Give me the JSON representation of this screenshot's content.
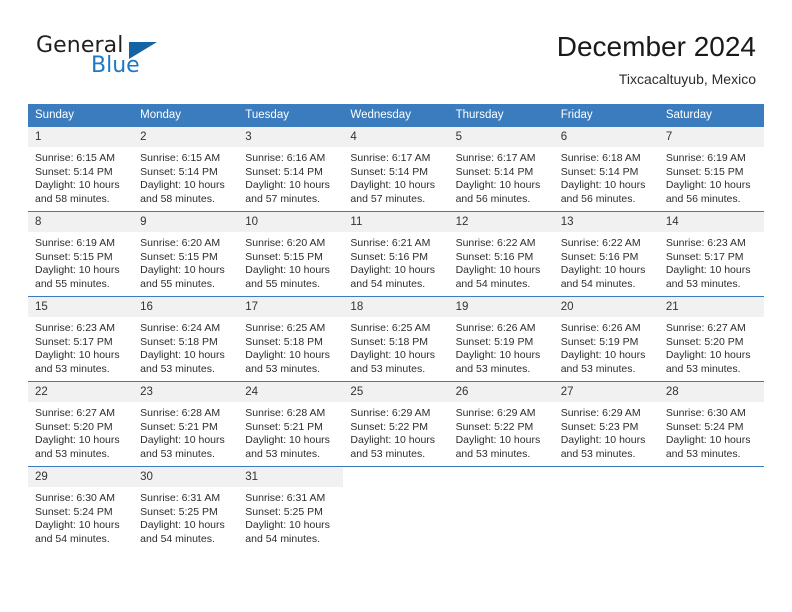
{
  "brand": {
    "name_part1": "General",
    "name_part2": "Blue",
    "triangle_color": "#1464a5",
    "blue_color": "#1e78c8"
  },
  "header": {
    "title": "December 2024",
    "subtitle": "Tixcacaltuyub, Mexico"
  },
  "theme": {
    "header_row_bg": "#3a7cbe",
    "daynum_bg": "#f1f1f1",
    "grid_line": "#3a7cbe",
    "text": "#2d2d2d"
  },
  "weekday_headers": [
    "Sunday",
    "Monday",
    "Tuesday",
    "Wednesday",
    "Thursday",
    "Friday",
    "Saturday"
  ],
  "weeks": [
    [
      {
        "day": "1",
        "sunrise": "Sunrise: 6:15 AM",
        "sunset": "Sunset: 5:14 PM",
        "daylight1": "Daylight: 10 hours",
        "daylight2": "and 58 minutes."
      },
      {
        "day": "2",
        "sunrise": "Sunrise: 6:15 AM",
        "sunset": "Sunset: 5:14 PM",
        "daylight1": "Daylight: 10 hours",
        "daylight2": "and 58 minutes."
      },
      {
        "day": "3",
        "sunrise": "Sunrise: 6:16 AM",
        "sunset": "Sunset: 5:14 PM",
        "daylight1": "Daylight: 10 hours",
        "daylight2": "and 57 minutes."
      },
      {
        "day": "4",
        "sunrise": "Sunrise: 6:17 AM",
        "sunset": "Sunset: 5:14 PM",
        "daylight1": "Daylight: 10 hours",
        "daylight2": "and 57 minutes."
      },
      {
        "day": "5",
        "sunrise": "Sunrise: 6:17 AM",
        "sunset": "Sunset: 5:14 PM",
        "daylight1": "Daylight: 10 hours",
        "daylight2": "and 56 minutes."
      },
      {
        "day": "6",
        "sunrise": "Sunrise: 6:18 AM",
        "sunset": "Sunset: 5:14 PM",
        "daylight1": "Daylight: 10 hours",
        "daylight2": "and 56 minutes."
      },
      {
        "day": "7",
        "sunrise": "Sunrise: 6:19 AM",
        "sunset": "Sunset: 5:15 PM",
        "daylight1": "Daylight: 10 hours",
        "daylight2": "and 56 minutes."
      }
    ],
    [
      {
        "day": "8",
        "sunrise": "Sunrise: 6:19 AM",
        "sunset": "Sunset: 5:15 PM",
        "daylight1": "Daylight: 10 hours",
        "daylight2": "and 55 minutes."
      },
      {
        "day": "9",
        "sunrise": "Sunrise: 6:20 AM",
        "sunset": "Sunset: 5:15 PM",
        "daylight1": "Daylight: 10 hours",
        "daylight2": "and 55 minutes."
      },
      {
        "day": "10",
        "sunrise": "Sunrise: 6:20 AM",
        "sunset": "Sunset: 5:15 PM",
        "daylight1": "Daylight: 10 hours",
        "daylight2": "and 55 minutes."
      },
      {
        "day": "11",
        "sunrise": "Sunrise: 6:21 AM",
        "sunset": "Sunset: 5:16 PM",
        "daylight1": "Daylight: 10 hours",
        "daylight2": "and 54 minutes."
      },
      {
        "day": "12",
        "sunrise": "Sunrise: 6:22 AM",
        "sunset": "Sunset: 5:16 PM",
        "daylight1": "Daylight: 10 hours",
        "daylight2": "and 54 minutes."
      },
      {
        "day": "13",
        "sunrise": "Sunrise: 6:22 AM",
        "sunset": "Sunset: 5:16 PM",
        "daylight1": "Daylight: 10 hours",
        "daylight2": "and 54 minutes."
      },
      {
        "day": "14",
        "sunrise": "Sunrise: 6:23 AM",
        "sunset": "Sunset: 5:17 PM",
        "daylight1": "Daylight: 10 hours",
        "daylight2": "and 53 minutes."
      }
    ],
    [
      {
        "day": "15",
        "sunrise": "Sunrise: 6:23 AM",
        "sunset": "Sunset: 5:17 PM",
        "daylight1": "Daylight: 10 hours",
        "daylight2": "and 53 minutes."
      },
      {
        "day": "16",
        "sunrise": "Sunrise: 6:24 AM",
        "sunset": "Sunset: 5:18 PM",
        "daylight1": "Daylight: 10 hours",
        "daylight2": "and 53 minutes."
      },
      {
        "day": "17",
        "sunrise": "Sunrise: 6:25 AM",
        "sunset": "Sunset: 5:18 PM",
        "daylight1": "Daylight: 10 hours",
        "daylight2": "and 53 minutes."
      },
      {
        "day": "18",
        "sunrise": "Sunrise: 6:25 AM",
        "sunset": "Sunset: 5:18 PM",
        "daylight1": "Daylight: 10 hours",
        "daylight2": "and 53 minutes."
      },
      {
        "day": "19",
        "sunrise": "Sunrise: 6:26 AM",
        "sunset": "Sunset: 5:19 PM",
        "daylight1": "Daylight: 10 hours",
        "daylight2": "and 53 minutes."
      },
      {
        "day": "20",
        "sunrise": "Sunrise: 6:26 AM",
        "sunset": "Sunset: 5:19 PM",
        "daylight1": "Daylight: 10 hours",
        "daylight2": "and 53 minutes."
      },
      {
        "day": "21",
        "sunrise": "Sunrise: 6:27 AM",
        "sunset": "Sunset: 5:20 PM",
        "daylight1": "Daylight: 10 hours",
        "daylight2": "and 53 minutes."
      }
    ],
    [
      {
        "day": "22",
        "sunrise": "Sunrise: 6:27 AM",
        "sunset": "Sunset: 5:20 PM",
        "daylight1": "Daylight: 10 hours",
        "daylight2": "and 53 minutes."
      },
      {
        "day": "23",
        "sunrise": "Sunrise: 6:28 AM",
        "sunset": "Sunset: 5:21 PM",
        "daylight1": "Daylight: 10 hours",
        "daylight2": "and 53 minutes."
      },
      {
        "day": "24",
        "sunrise": "Sunrise: 6:28 AM",
        "sunset": "Sunset: 5:21 PM",
        "daylight1": "Daylight: 10 hours",
        "daylight2": "and 53 minutes."
      },
      {
        "day": "25",
        "sunrise": "Sunrise: 6:29 AM",
        "sunset": "Sunset: 5:22 PM",
        "daylight1": "Daylight: 10 hours",
        "daylight2": "and 53 minutes."
      },
      {
        "day": "26",
        "sunrise": "Sunrise: 6:29 AM",
        "sunset": "Sunset: 5:22 PM",
        "daylight1": "Daylight: 10 hours",
        "daylight2": "and 53 minutes."
      },
      {
        "day": "27",
        "sunrise": "Sunrise: 6:29 AM",
        "sunset": "Sunset: 5:23 PM",
        "daylight1": "Daylight: 10 hours",
        "daylight2": "and 53 minutes."
      },
      {
        "day": "28",
        "sunrise": "Sunrise: 6:30 AM",
        "sunset": "Sunset: 5:24 PM",
        "daylight1": "Daylight: 10 hours",
        "daylight2": "and 53 minutes."
      }
    ],
    [
      {
        "day": "29",
        "sunrise": "Sunrise: 6:30 AM",
        "sunset": "Sunset: 5:24 PM",
        "daylight1": "Daylight: 10 hours",
        "daylight2": "and 54 minutes."
      },
      {
        "day": "30",
        "sunrise": "Sunrise: 6:31 AM",
        "sunset": "Sunset: 5:25 PM",
        "daylight1": "Daylight: 10 hours",
        "daylight2": "and 54 minutes."
      },
      {
        "day": "31",
        "sunrise": "Sunrise: 6:31 AM",
        "sunset": "Sunset: 5:25 PM",
        "daylight1": "Daylight: 10 hours",
        "daylight2": "and 54 minutes."
      },
      {
        "day": "",
        "sunrise": "",
        "sunset": "",
        "daylight1": "",
        "daylight2": ""
      },
      {
        "day": "",
        "sunrise": "",
        "sunset": "",
        "daylight1": "",
        "daylight2": ""
      },
      {
        "day": "",
        "sunrise": "",
        "sunset": "",
        "daylight1": "",
        "daylight2": ""
      },
      {
        "day": "",
        "sunrise": "",
        "sunset": "",
        "daylight1": "",
        "daylight2": ""
      }
    ]
  ]
}
